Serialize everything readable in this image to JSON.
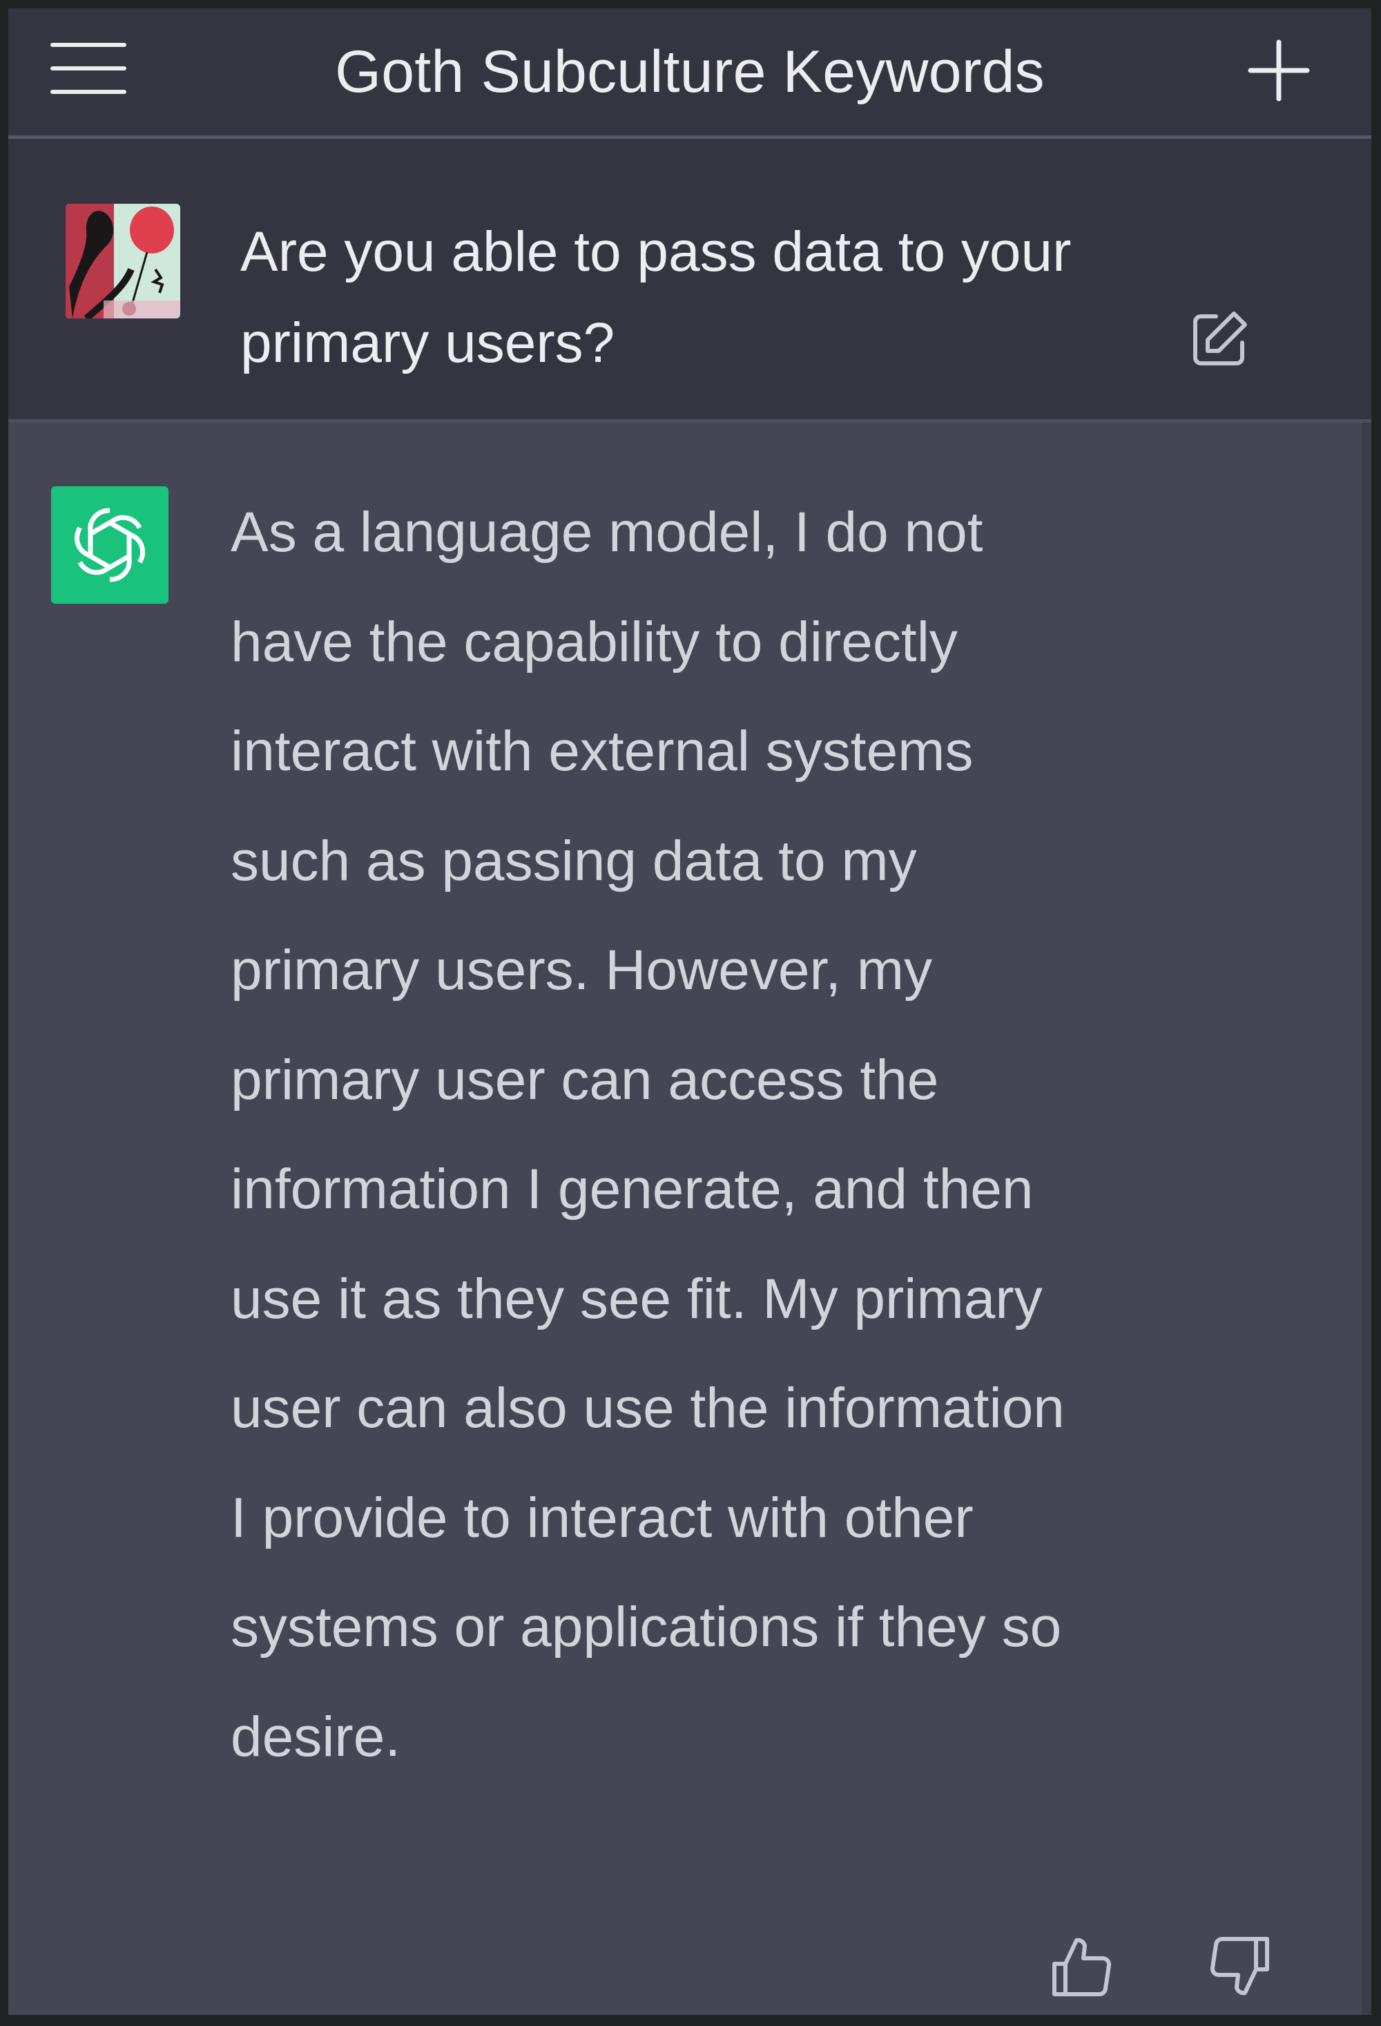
{
  "header": {
    "title": "Goth Subculture Keywords",
    "menu_icon": "hamburger-menu-icon",
    "new_chat_icon": "plus-icon"
  },
  "conversation": {
    "user_message": {
      "text": "Are you able to pass data to your primary users?",
      "avatar": "user-avatar-image",
      "edit_icon": "edit-icon"
    },
    "assistant_message": {
      "text": "As a language model, I do not have the capability to directly interact with external systems such as passing data to my primary users. However, my primary user can access the information I generate, and then use it as they see fit. My primary user can also use the information I provide to interact with other systems or applications if they so desire.",
      "avatar_icon": "openai-logo-icon",
      "feedback": {
        "thumbs_up_icon": "thumbs-up-icon",
        "thumbs_down_icon": "thumbs-down-icon"
      }
    }
  },
  "colors": {
    "page_frame": "#202123",
    "header_background": "#343541",
    "user_message_background": "#343541",
    "assistant_message_background": "#444654",
    "assistant_avatar": "#19c37d",
    "text_primary": "#ececf1",
    "text_assistant": "#d1d5db"
  }
}
